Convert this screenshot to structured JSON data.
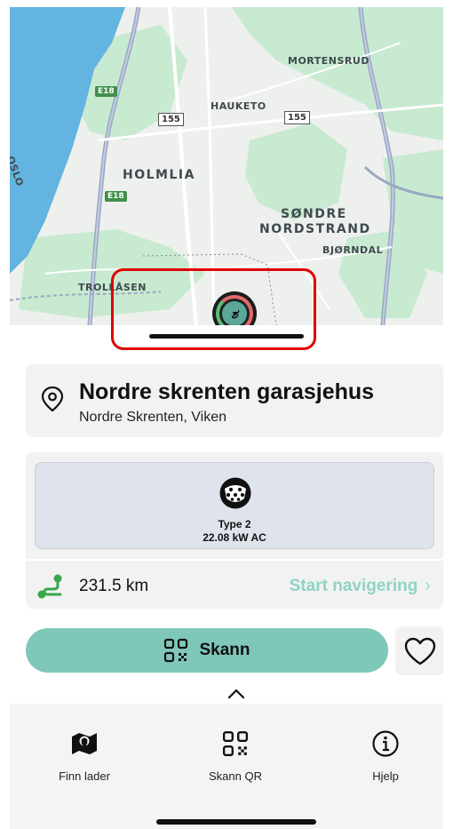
{
  "map": {
    "labels": {
      "mortensrud": "MORTENSRUD",
      "hauketo": "HAUKETO",
      "oslo": "OSLO",
      "holmlia": "HOLMLIA",
      "sondre": "SØNDRE",
      "nordstrand": "NORDSTRAND",
      "bjorndal": "BJØRNDAL",
      "trollasen": "TROLLÅSEN"
    },
    "shields": {
      "r155a": "155",
      "r155b": "155",
      "e18a": "E18",
      "e18b": "E18"
    },
    "marker_glyph": "ಶ"
  },
  "station": {
    "name": "Nordre skrenten garasjehus",
    "address": "Nordre Skrenten, Viken"
  },
  "connector": {
    "type": "Type 2",
    "power": "22.08 kW AC"
  },
  "route": {
    "distance": "231.5 km",
    "start_nav_label": "Start navigering",
    "chevron": "›"
  },
  "actions": {
    "scan_label": "Skann"
  },
  "bottom_nav": {
    "items": [
      {
        "label": "Finn lader",
        "icon": "map-icon"
      },
      {
        "label": "Skann QR",
        "icon": "qr-icon"
      },
      {
        "label": "Hjelp",
        "icon": "info-icon"
      }
    ]
  },
  "colors": {
    "accent": "#7fc8b9",
    "accent_text": "#8fd3c5",
    "route_green": "#3aa74a",
    "highlight": "#e00000",
    "water": "#63b4e0",
    "forest": "#c7ead0"
  }
}
